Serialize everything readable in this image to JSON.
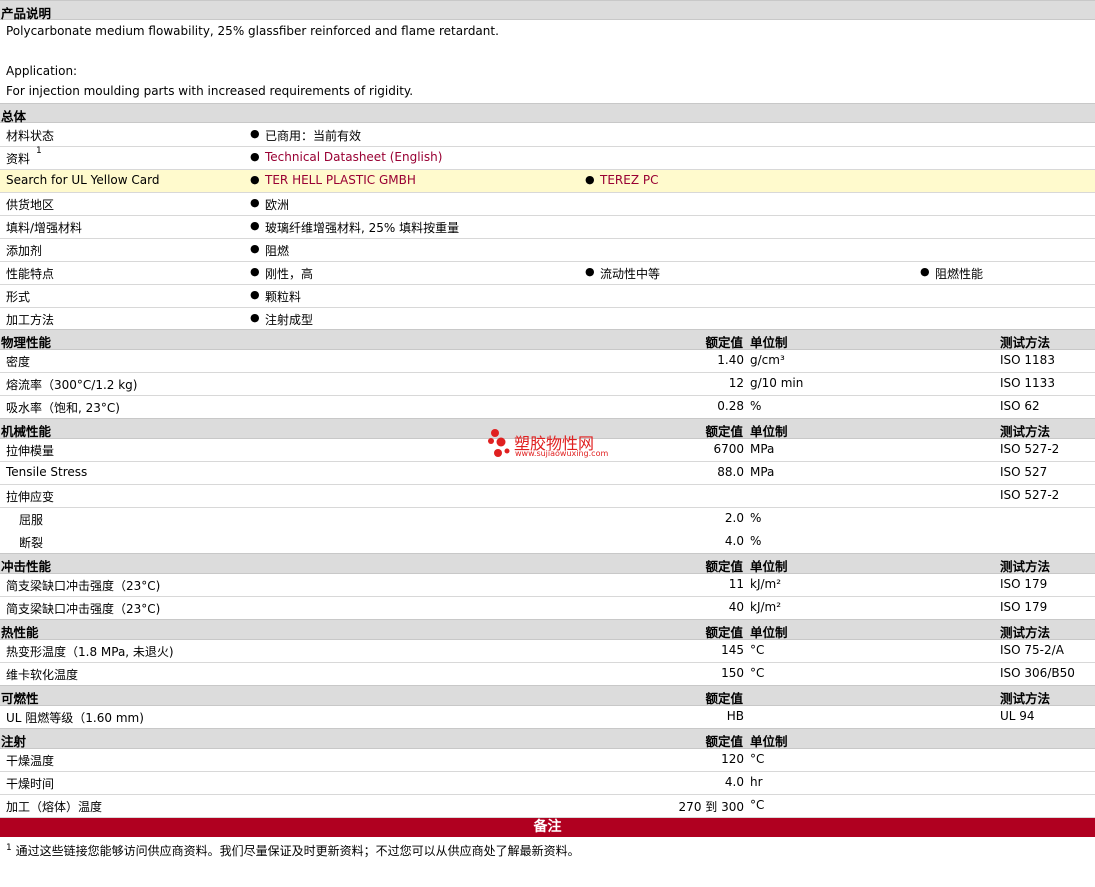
{
  "desc": {
    "title": "产品说明",
    "line1": "Polycarbonate medium flowability, 25% glassfiber reinforced and flame retardant.",
    "line2": "Application:",
    "line3": "For injection moulding parts with increased requirements of rigidity."
  },
  "general": {
    "title": "总体",
    "rows": [
      {
        "label": "材料状态",
        "items": [
          "已商用：当前有效"
        ]
      },
      {
        "label": "资料",
        "sup": "1",
        "items": [
          "Technical Datasheet (English)"
        ]
      },
      {
        "label": "Search for UL Yellow Card",
        "items": [
          "TER HELL PLASTIC GMBH",
          "TEREZ PC"
        ]
      },
      {
        "label": "供货地区",
        "items": [
          "欧洲"
        ]
      },
      {
        "label": "填料/增强材料",
        "items": [
          "玻璃纤维增强材料, 25% 填料按重量"
        ]
      },
      {
        "label": "添加剂",
        "items": [
          "阻燃"
        ]
      },
      {
        "label": "性能特点",
        "items": [
          "刚性，高",
          "流动性中等",
          "阻燃性能"
        ]
      },
      {
        "label": "形式",
        "items": [
          "颗粒料"
        ]
      },
      {
        "label": "加工方法",
        "items": [
          "注射成型"
        ]
      }
    ]
  },
  "columns": {
    "nominal": "额定值",
    "unit": "单位制",
    "test": "测试方法"
  },
  "physical": {
    "title": "物理性能",
    "rows": [
      {
        "label": "密度",
        "value": "1.40",
        "unit": "g/cm³",
        "test": "ISO 1183"
      },
      {
        "label": "熔流率（300°C/1.2 kg)",
        "value": "12",
        "unit": "g/10 min",
        "test": "ISO 1133"
      },
      {
        "label": "吸水率（饱和, 23°C)",
        "value": "0.28",
        "unit": "%",
        "test": "ISO 62"
      }
    ]
  },
  "mechanical": {
    "title": "机械性能",
    "rows": [
      {
        "label": "拉伸模量",
        "value": "6700",
        "unit": "MPa",
        "test": "ISO 527-2"
      },
      {
        "label": "Tensile Stress",
        "value": "88.0",
        "unit": "MPa",
        "test": "ISO 527"
      },
      {
        "label": "拉伸应变",
        "value": "",
        "unit": "",
        "test": "ISO 527-2"
      },
      {
        "label": "屈服",
        "value": "2.0",
        "unit": "%",
        "test": ""
      },
      {
        "label": "断裂",
        "value": "4.0",
        "unit": "%",
        "test": ""
      }
    ]
  },
  "impact": {
    "title": "冲击性能",
    "rows": [
      {
        "label": "简支梁缺口冲击强度（23°C)",
        "value": "11",
        "unit": "kJ/m²",
        "test": "ISO 179"
      },
      {
        "label": "简支梁缺口冲击强度（23°C)",
        "value": "40",
        "unit": "kJ/m²",
        "test": "ISO 179"
      }
    ]
  },
  "thermal": {
    "title": "热性能",
    "rows": [
      {
        "label": "热变形温度（1.8 MPa, 未退火)",
        "value": "145",
        "unit": "°C",
        "test": "ISO 75-2/A"
      },
      {
        "label": "维卡软化温度",
        "value": "150",
        "unit": "°C",
        "test": "ISO 306/B50"
      }
    ]
  },
  "flammability": {
    "title": "可燃性",
    "rows": [
      {
        "label": "UL 阻燃等级（1.60 mm)",
        "value": "HB",
        "unit": "",
        "test": "UL 94"
      }
    ]
  },
  "injection": {
    "title": "注射",
    "rows": [
      {
        "label": "干燥温度",
        "value": "120",
        "unit": "°C",
        "test": ""
      },
      {
        "label": "干燥时间",
        "value": "4.0",
        "unit": "hr",
        "test": ""
      },
      {
        "label": "加工（熔体）温度",
        "value": "270 到  300",
        "unit": "°C",
        "test": ""
      }
    ]
  },
  "notes": {
    "title": "备注",
    "sup": "1",
    "text": "通过这些链接您能够访问供应商资料。我们尽量保证及时更新资料；不过您可以从供应商处了解最新资料。"
  },
  "watermark": {
    "name": "塑胶物性网",
    "url": "www.sujiaowuxing.com"
  },
  "colors": {
    "highlight": "#fffacd",
    "header": "#dcdcdc",
    "link": "#990033",
    "notes": "#b00020"
  }
}
